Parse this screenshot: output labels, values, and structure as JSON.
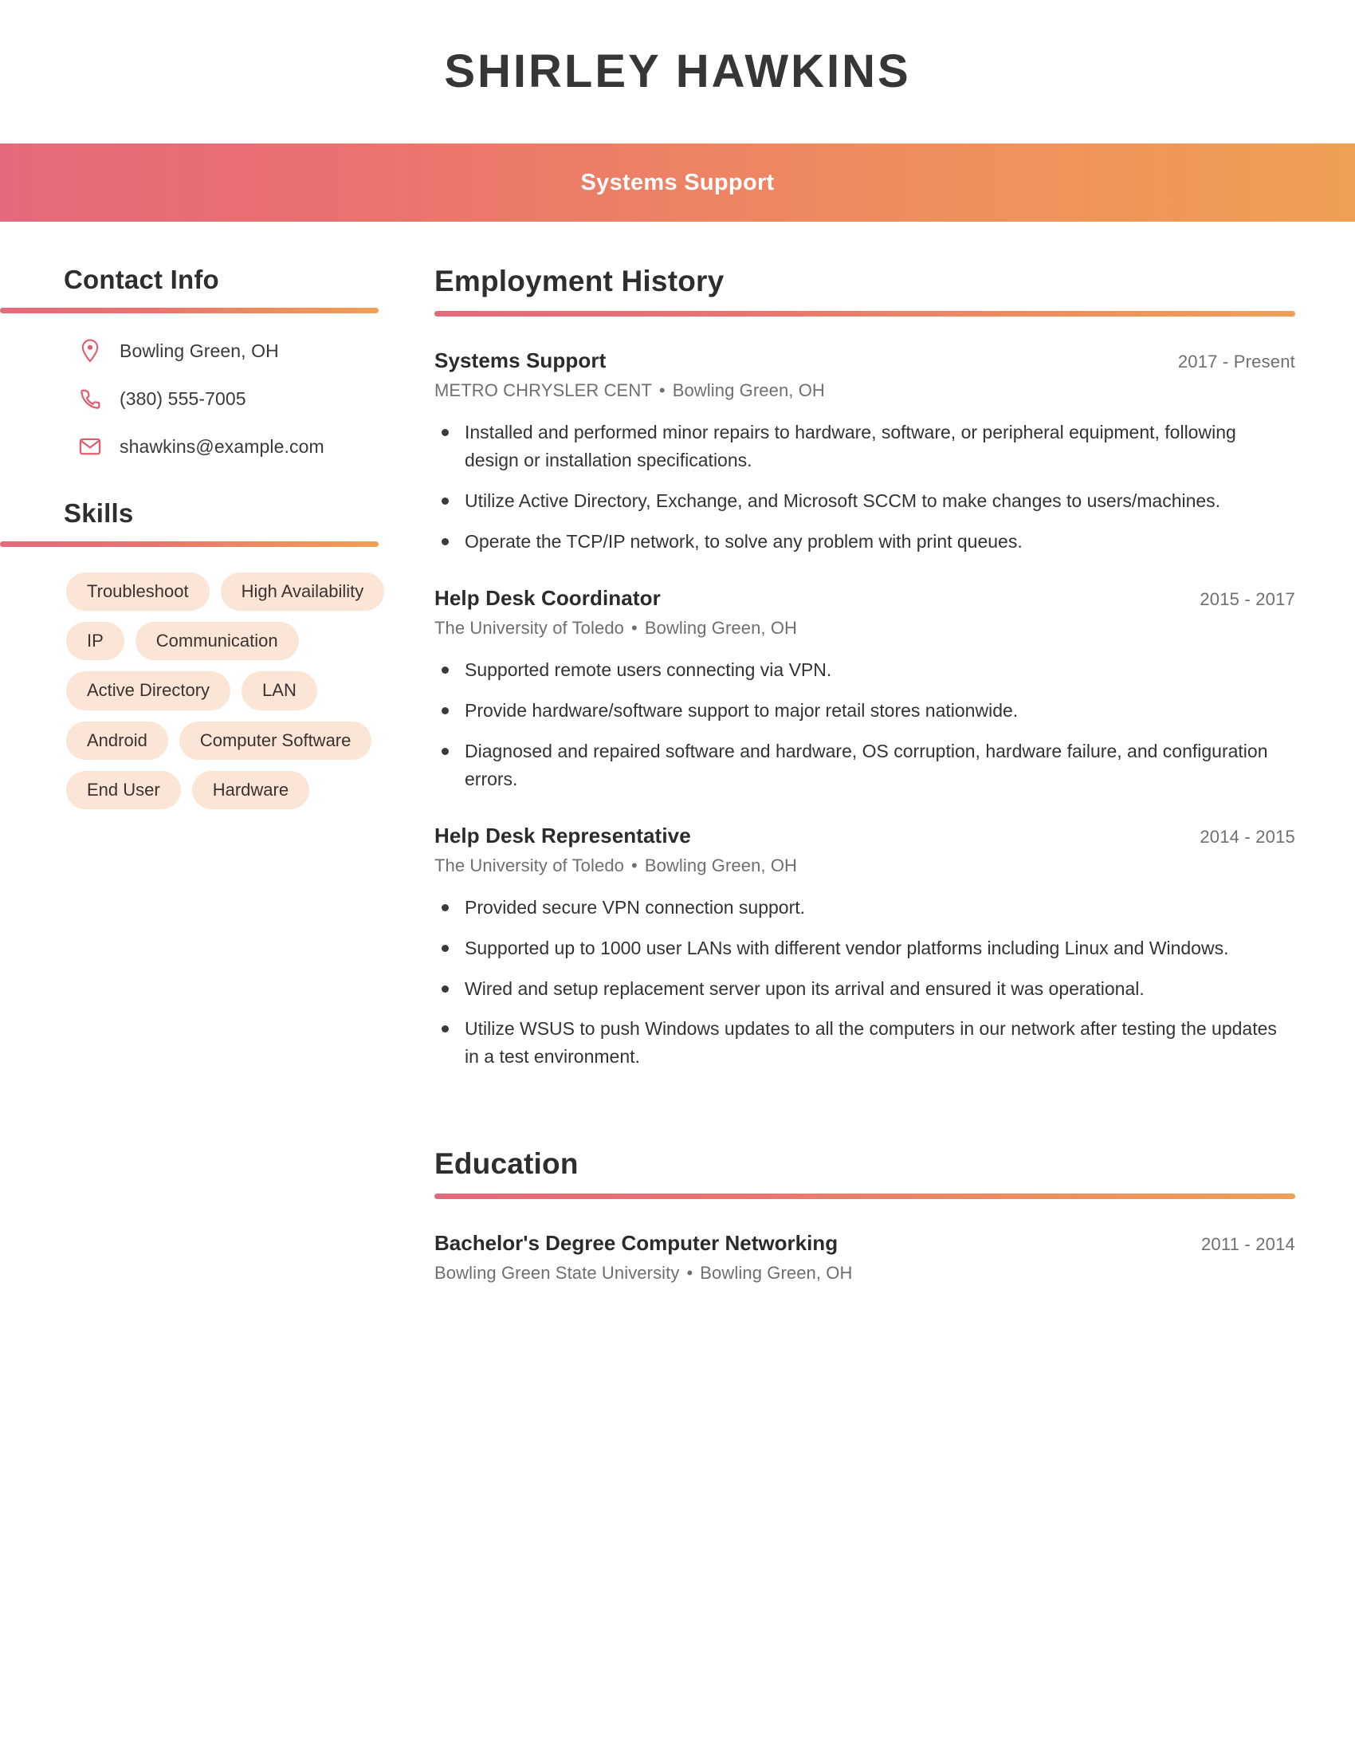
{
  "header": {
    "name": "SHIRLEY HAWKINS",
    "banner_title": "Systems Support"
  },
  "theme": {
    "gradient_start": "#e4697c",
    "gradient_end": "#eea055",
    "icon_color": "#e05c6e",
    "tag_background": "#fae5d6",
    "heading_color": "#2e2e2e",
    "muted_text": "#6f6f6f"
  },
  "sidebar": {
    "contact": {
      "heading": "Contact Info",
      "items": [
        {
          "icon": "location-pin-icon",
          "value": "Bowling Green, OH"
        },
        {
          "icon": "phone-icon",
          "value": "(380) 555-7005"
        },
        {
          "icon": "envelope-icon",
          "value": "shawkins@example.com"
        }
      ]
    },
    "skills": {
      "heading": "Skills",
      "items": [
        "Troubleshoot",
        "High Availability",
        "IP",
        "Communication",
        "Active Directory",
        "LAN",
        "Android",
        "Computer Software",
        "End User",
        "Hardware"
      ]
    }
  },
  "main": {
    "employment": {
      "heading": "Employment History",
      "entries": [
        {
          "role": "Systems Support",
          "dates": "2017 - Present",
          "company": "METRO CHRYSLER CENT",
          "location": "Bowling Green, OH",
          "separator": "•",
          "bullets": [
            "Installed and performed minor repairs to hardware, software, or peripheral equipment, following design or installation specifications.",
            "Utilize Active Directory, Exchange, and Microsoft SCCM to make changes to users/machines.",
            "Operate the TCP/IP network, to solve any problem with print queues."
          ]
        },
        {
          "role": "Help Desk Coordinator",
          "dates": "2015 - 2017",
          "company": "The University of Toledo",
          "location": "Bowling Green, OH",
          "separator": "•",
          "bullets": [
            "Supported remote users connecting via VPN.",
            "Provide hardware/software support to major retail stores nationwide.",
            "Diagnosed and repaired software and hardware, OS corruption, hardware failure, and configuration errors."
          ]
        },
        {
          "role": "Help Desk Representative",
          "dates": "2014 - 2015",
          "company": "The University of Toledo",
          "location": "Bowling Green, OH",
          "separator": "•",
          "bullets": [
            "Provided secure VPN connection support.",
            "Supported up to 1000 user LANs with different vendor platforms including Linux and Windows.",
            "Wired and setup replacement server upon its arrival and ensured it was operational.",
            "Utilize WSUS to push Windows updates to all the computers in our network after testing the updates in a test environment."
          ]
        }
      ]
    },
    "education": {
      "heading": "Education",
      "entries": [
        {
          "degree": "Bachelor's Degree Computer Networking",
          "dates": "2011 - 2014",
          "school": "Bowling Green State University",
          "location": "Bowling Green, OH",
          "separator": "•"
        }
      ]
    }
  }
}
